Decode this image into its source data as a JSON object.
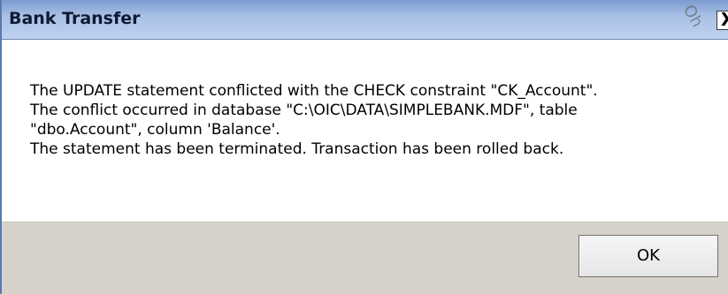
{
  "dialog": {
    "title": "Bank Transfer",
    "close_label": "X",
    "watermark": "Oh",
    "message_lines": [
      "The UPDATE statement conflicted with the CHECK constraint \"CK_Account\".",
      "The conflict occurred in database \"C:\\OIC\\DATA\\SIMPLEBANK.MDF\", table",
      "\"dbo.Account\", column 'Balance'.",
      "The statement has been terminated. Transaction has been rolled back."
    ],
    "ok_label": "OK"
  },
  "colors": {
    "titlebar": "#a8c0e6",
    "footer": "#d6d2ca",
    "content": "#ffffff"
  }
}
